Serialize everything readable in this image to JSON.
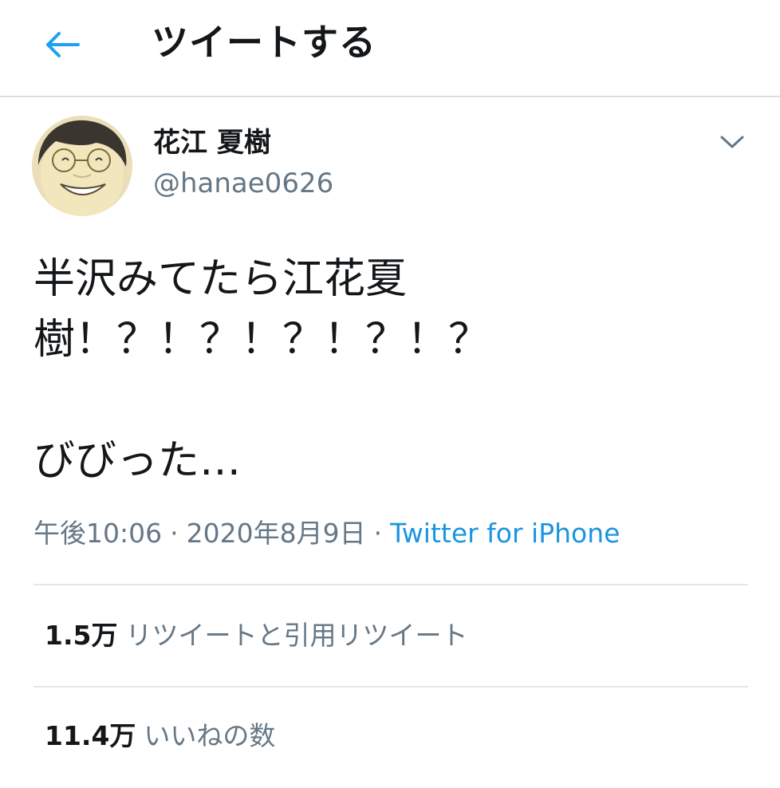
{
  "header": {
    "back_icon": "arrow-left-icon",
    "title": "ツイートする",
    "accent_color": "#1da1f2"
  },
  "tweet": {
    "author": {
      "display_name": "花江 夏樹",
      "handle": "@hanae0626"
    },
    "menu_icon": "chevron-down-icon",
    "text": "半沢みてたら江花夏\n樹！？！？！？！？！？\n\nびびった…",
    "time": "午後10:06",
    "separator": "·",
    "date": "2020年8月9日",
    "source": "Twitter for iPhone",
    "stats": {
      "retweets_count": "1.5万",
      "retweets_label": "リツイートと引用リツイート",
      "likes_count": "11.4万",
      "likes_label": "いいねの数"
    }
  }
}
